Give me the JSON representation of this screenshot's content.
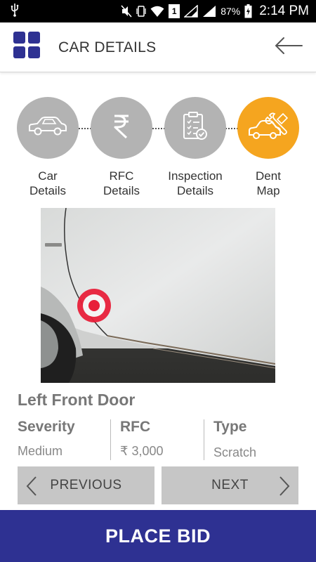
{
  "status_bar": {
    "battery_percent": "87%",
    "time": "2:14 PM",
    "sim_slot": "1",
    "icons": [
      "usb-icon",
      "mute-icon",
      "vibrate-icon",
      "wifi-icon",
      "sim-icon",
      "signal-icon",
      "signal-icon",
      "battery-charging-icon"
    ]
  },
  "header": {
    "title": "CAR DETAILS",
    "menu_icon": "grid-menu-icon",
    "back_icon": "back-arrow-icon",
    "brand_color": "#2e3192"
  },
  "steps": [
    {
      "label_line1": "Car",
      "label_line2": "Details",
      "icon": "car-icon",
      "active": false
    },
    {
      "label_line1": "RFC",
      "label_line2": "Details",
      "icon": "rupee-icon",
      "active": false
    },
    {
      "label_line1": "Inspection",
      "label_line2": "Details",
      "icon": "clipboard-check-icon",
      "active": false
    },
    {
      "label_line1": "Dent",
      "label_line2": "Map",
      "icon": "car-repair-icon",
      "active": true
    }
  ],
  "step_colors": {
    "inactive": "#b3b3b3",
    "active": "#f5a51f"
  },
  "photo": {
    "subject": "car-door-photo",
    "marker": "target-marker-icon",
    "marker_color": "#e8203a"
  },
  "damage": {
    "part": "Left Front Door",
    "severity_label": "Severity",
    "severity_value": "Medium",
    "rfc_label": "RFC",
    "rfc_value": "₹ 3,000",
    "type_label": "Type",
    "type_value": "Scratch"
  },
  "nav": {
    "previous_label": "PREVIOUS",
    "next_label": "NEXT"
  },
  "actions": {
    "place_bid_label": "PLACE BID"
  }
}
